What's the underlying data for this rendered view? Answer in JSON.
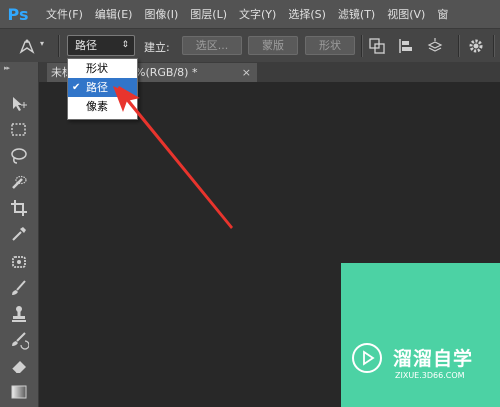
{
  "app": {
    "logo": "Ps"
  },
  "menu": [
    "文件(F)",
    "编辑(E)",
    "图像(I)",
    "图层(L)",
    "文字(Y)",
    "选择(S)",
    "滤镜(T)",
    "视图(V)",
    "窗"
  ],
  "options": {
    "mode_value": "路径",
    "build_label": "建立:",
    "btn_selection": "选区...",
    "btn_mask": "蒙版",
    "btn_shape": "形状"
  },
  "dropdown": {
    "items": [
      {
        "label": "形状",
        "selected": false
      },
      {
        "label": "路径",
        "selected": true
      },
      {
        "label": "像素",
        "selected": false
      }
    ]
  },
  "document": {
    "tab_prefix": "未标",
    "tab_suffix": "%(RGB/8) *",
    "close": "×"
  },
  "watermark": {
    "title": "溜溜自学",
    "url": "ZIXUE.3D66.COM"
  },
  "colors": {
    "accent": "#3175c9",
    "arrow": "#e8342d",
    "doc_image": "#4cd2a4"
  },
  "tools": [
    "move-icon",
    "marquee-icon",
    "lasso-icon",
    "quick-select-icon",
    "crop-icon",
    "eyedropper-icon",
    "healing-icon",
    "brush-icon",
    "stamp-icon",
    "history-brush-icon",
    "eraser-icon",
    "gradient-icon"
  ]
}
